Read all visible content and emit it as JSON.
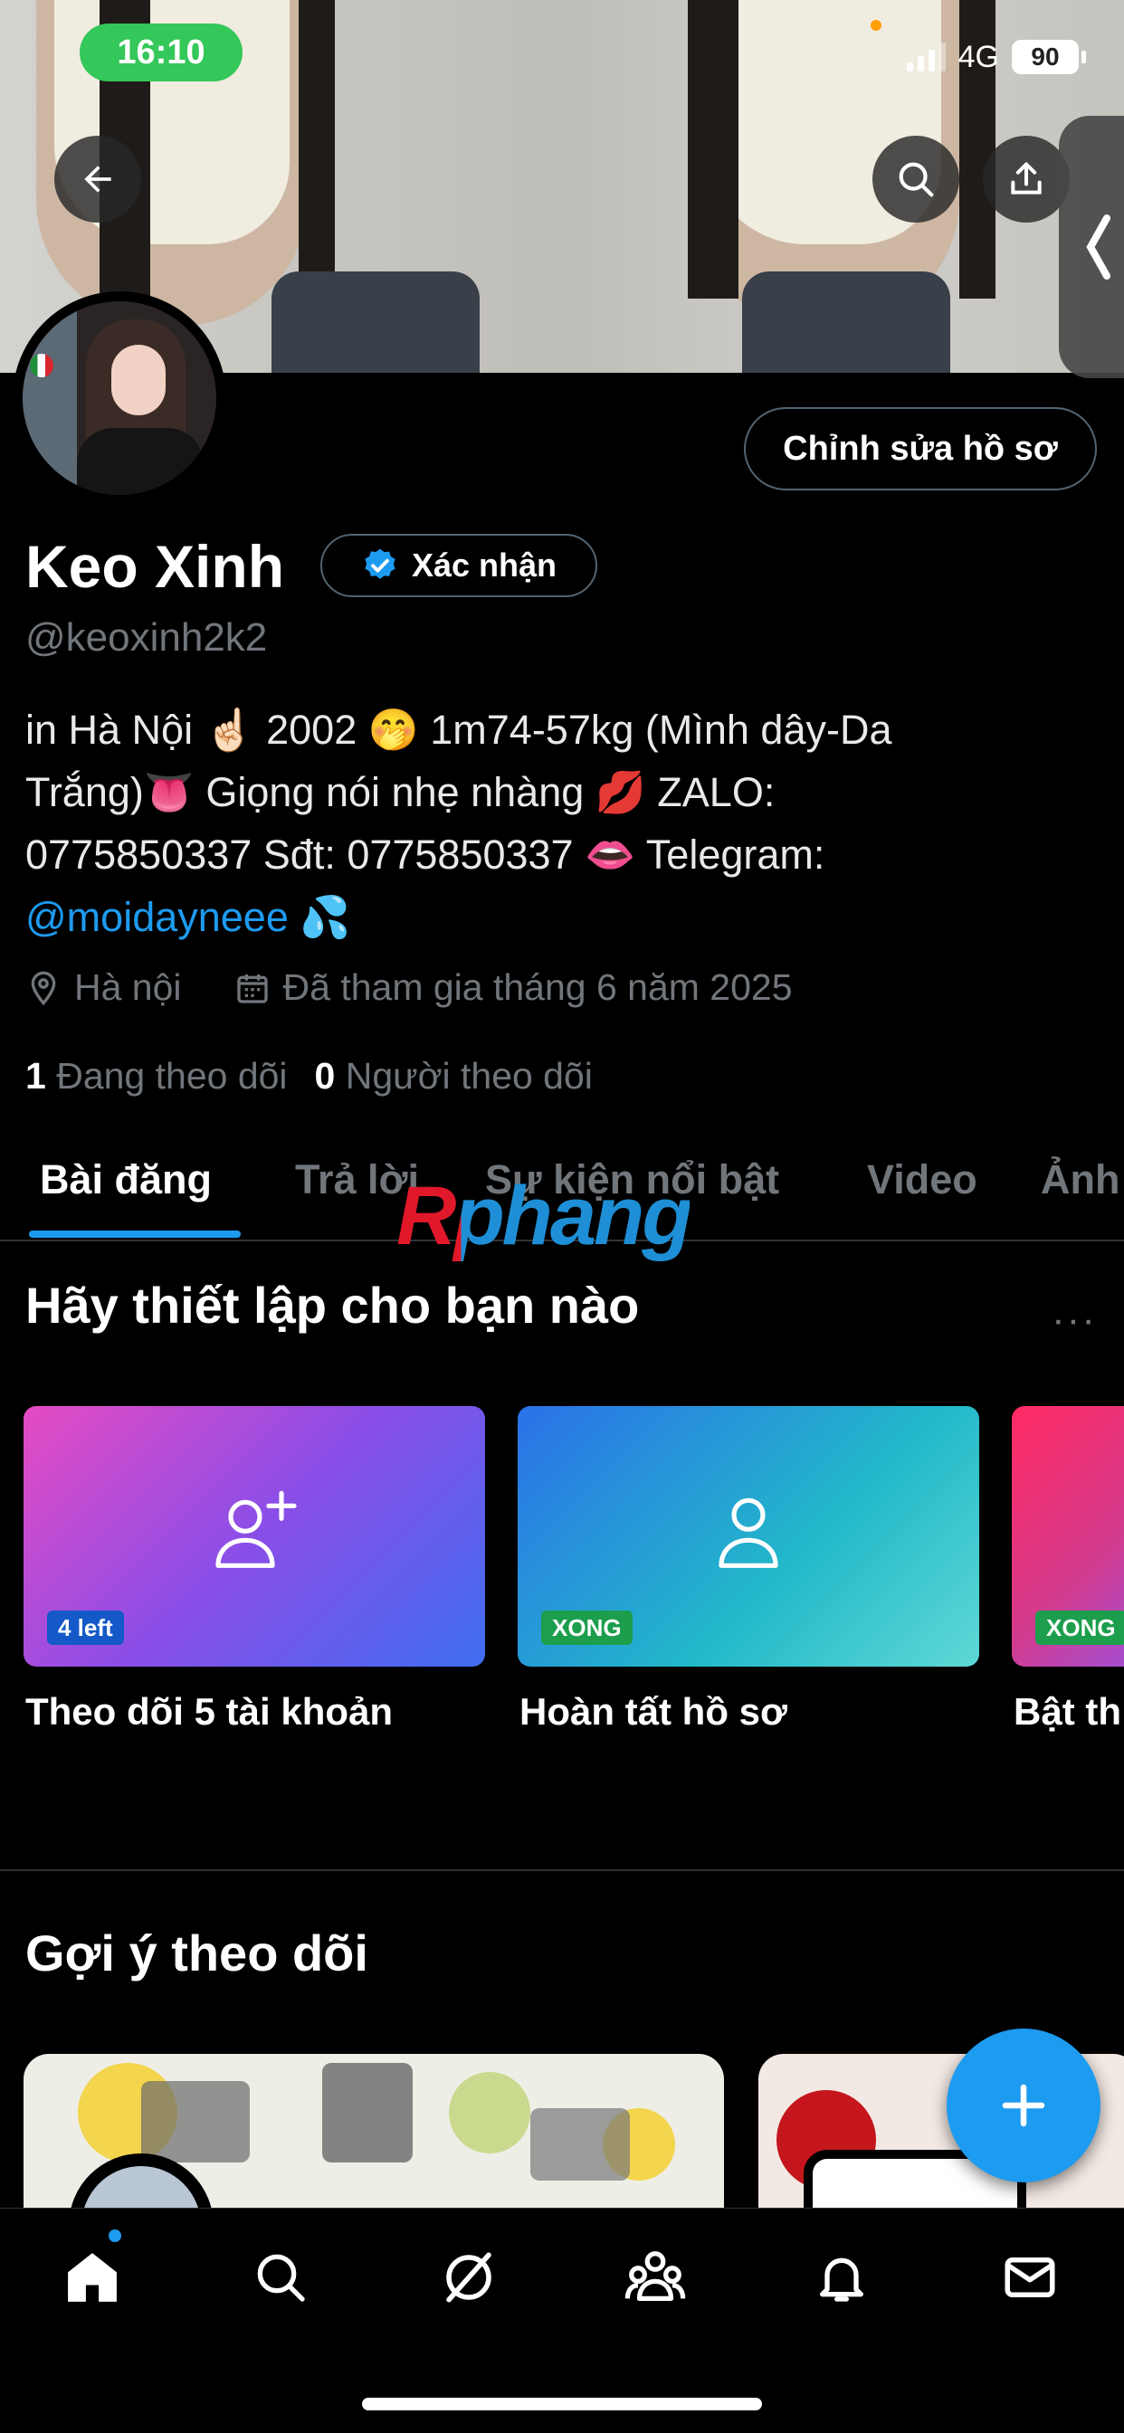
{
  "status_bar": {
    "time": "16:10",
    "network": "4G",
    "battery": "90"
  },
  "profile": {
    "edit_button": "Chỉnh sửa hồ sơ",
    "name": "Keo Xinh",
    "verify_label": "Xác nhận",
    "handle": "@keoxinh2k2",
    "bio_line1": "in Hà Nội ☝🏻 2002 🤭 1m74-57kg (Mình dây-Da",
    "bio_line2": "Trắng)👅 Giọng nói nhẹ nhàng 💋 ZALO:",
    "bio_line3": "0775850337 Sđt: 0775850337 👄 Telegram:",
    "bio_link": "@moidayneee",
    "bio_link_emoji": "💦",
    "location": "Hà nội",
    "joined": "Đã tham gia tháng 6 năm 2025",
    "following_count": "1",
    "following_label": "Đang theo dõi",
    "followers_count": "0",
    "followers_label": "Người theo dõi"
  },
  "tabs": [
    "Bài đăng",
    "Trả lời",
    "Sự kiện nổi bật",
    "Video",
    "Ảnh"
  ],
  "watermark": "Rphang",
  "setup": {
    "title": "Hãy thiết lập cho bạn nào",
    "more": "···",
    "cards": [
      {
        "label": "Theo dõi 5 tài khoản",
        "badge": "4 left",
        "icon": "add-user-icon"
      },
      {
        "label": "Hoàn tất hồ sơ",
        "badge": "XONG",
        "icon": "user-icon"
      },
      {
        "label": "Bật th",
        "badge": "XONG",
        "icon": ""
      }
    ]
  },
  "suggestions": {
    "title": "Gợi ý theo dõi"
  },
  "nav": [
    "home-icon",
    "search-icon",
    "grok-icon",
    "communities-icon",
    "bell-icon",
    "mail-icon"
  ],
  "colors": {
    "accent": "#1d9bf0",
    "status_green": "#34c759",
    "badge_green": "#1c9e4c"
  }
}
